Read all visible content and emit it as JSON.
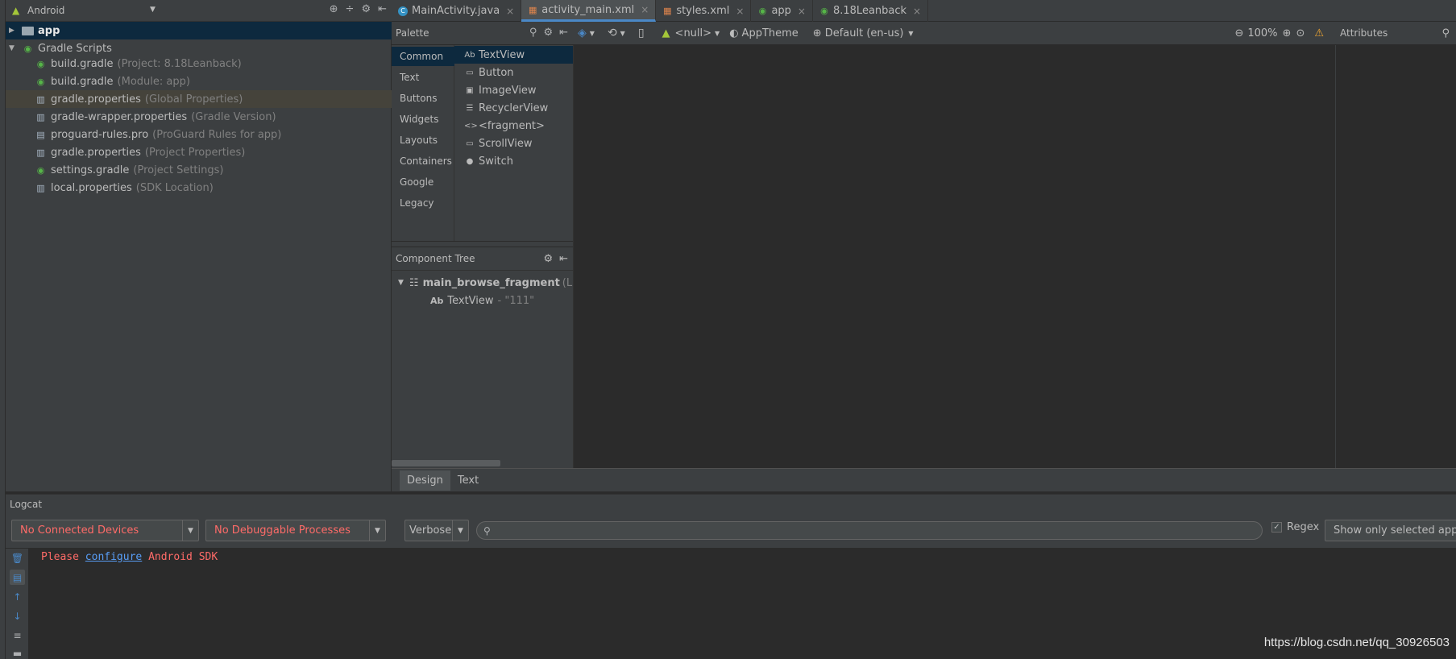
{
  "project_panel": {
    "view_mode": "Android",
    "tree": [
      {
        "name": "app",
        "hint": "",
        "bold": true,
        "icon": "folder-icon"
      },
      {
        "name": "Gradle Scripts",
        "hint": "",
        "icon": "gradle-icon"
      },
      {
        "name": "build.gradle",
        "hint": "(Project: 8.18Leanback)",
        "icon": "gradle-icon"
      },
      {
        "name": "build.gradle",
        "hint": "(Module: app)",
        "icon": "gradle-icon"
      },
      {
        "name": "gradle.properties",
        "hint": "(Global Properties)",
        "icon": "properties-icon"
      },
      {
        "name": "gradle-wrapper.properties",
        "hint": "(Gradle Version)",
        "icon": "properties-icon"
      },
      {
        "name": "proguard-rules.pro",
        "hint": "(ProGuard Rules for app)",
        "icon": "file-icon"
      },
      {
        "name": "gradle.properties",
        "hint": "(Project Properties)",
        "icon": "properties-icon"
      },
      {
        "name": "settings.gradle",
        "hint": "(Project Settings)",
        "icon": "gradle-icon"
      },
      {
        "name": "local.properties",
        "hint": "(SDK Location)",
        "icon": "properties-icon"
      }
    ]
  },
  "editor_tabs": [
    {
      "label": "MainActivity.java",
      "icon": "java-class-icon",
      "active": false
    },
    {
      "label": "activity_main.xml",
      "icon": "xml-layout-icon",
      "active": true
    },
    {
      "label": "styles.xml",
      "icon": "xml-icon",
      "active": false
    },
    {
      "label": "app",
      "icon": "gradle-icon",
      "active": false
    },
    {
      "label": "8.18Leanback",
      "icon": "gradle-icon",
      "active": false
    }
  ],
  "palette": {
    "title": "Palette",
    "categories": [
      "Common",
      "Text",
      "Buttons",
      "Widgets",
      "Layouts",
      "Containers",
      "Google",
      "Legacy"
    ],
    "selected_category": "Common",
    "items": [
      {
        "prefix": "Ab",
        "label": "TextView"
      },
      {
        "prefix": "▭",
        "label": "Button"
      },
      {
        "prefix": "▣",
        "label": "ImageView"
      },
      {
        "prefix": "☰",
        "label": "RecyclerView"
      },
      {
        "prefix": "<>",
        "label": "<fragment>"
      },
      {
        "prefix": "▭",
        "label": "ScrollView"
      },
      {
        "prefix": "●",
        "label": "Switch"
      }
    ]
  },
  "design_toolbar": {
    "api": "<null>",
    "theme": "AppTheme",
    "locale": "Default (en-us)",
    "zoom": "100%"
  },
  "attributes": {
    "title": "Attributes"
  },
  "component_tree": {
    "title": "Component Tree",
    "root": "main_browse_fragment",
    "root_suffix": "(Li",
    "child_prefix": "Ab",
    "child": "TextView",
    "child_value": "- \"111\""
  },
  "bottom_tabs": [
    {
      "label": "Design",
      "active": true
    },
    {
      "label": "Text",
      "active": false
    }
  ],
  "logcat": {
    "title": "Logcat",
    "device": "No Connected Devices",
    "process": "No Debuggable Processes",
    "level": "Verbose",
    "search_value": "",
    "regex_label": "Regex",
    "regex_checked": true,
    "filter": "Show only selected appli",
    "message_pre": "Please",
    "message_link": "configure",
    "message_post": "Android SDK"
  },
  "watermark": "https://blog.csdn.net/qq_30926503"
}
